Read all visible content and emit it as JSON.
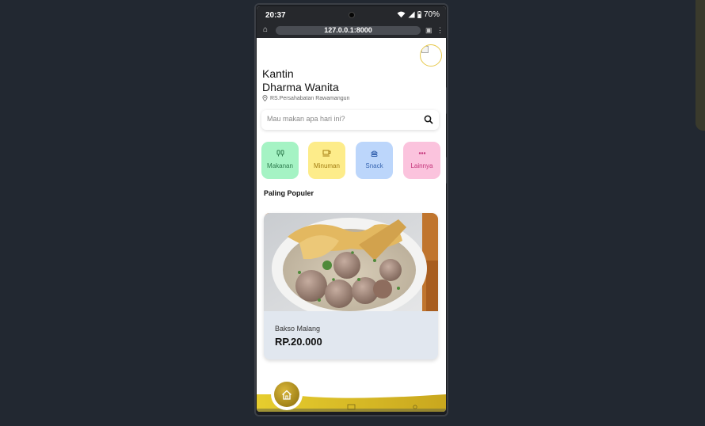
{
  "status": {
    "time": "20:37",
    "battery": "70%"
  },
  "browser": {
    "url": "127.0.0.1:8000"
  },
  "header": {
    "title_line1": "Kantin",
    "title_line2": "Dharma Wanita",
    "location": "RS.Persahabatan Rawamangun"
  },
  "search": {
    "placeholder": "Mau makan apa hari ini?",
    "value": ""
  },
  "categories": [
    {
      "label": "Makanan",
      "icon": "utensils-icon",
      "bg": "#a5f3c4",
      "color": "#2f7d4f"
    },
    {
      "label": "Minuman",
      "icon": "cup-icon",
      "bg": "#fdec8a",
      "color": "#a37d12"
    },
    {
      "label": "Snack",
      "icon": "burger-icon",
      "bg": "#bcd6fb",
      "color": "#3a68b3"
    },
    {
      "label": "Lainnya",
      "icon": "more-dots-icon",
      "bg": "#fbc3dd",
      "color": "#c4337a"
    }
  ],
  "popular": {
    "title": "Paling Populer",
    "items": [
      {
        "name": "Bakso Malang",
        "price": "RP.20.000",
        "image": "bakso-food-photo"
      }
    ]
  },
  "nav": {
    "active": "home-icon",
    "accent": "#c9a71e"
  }
}
